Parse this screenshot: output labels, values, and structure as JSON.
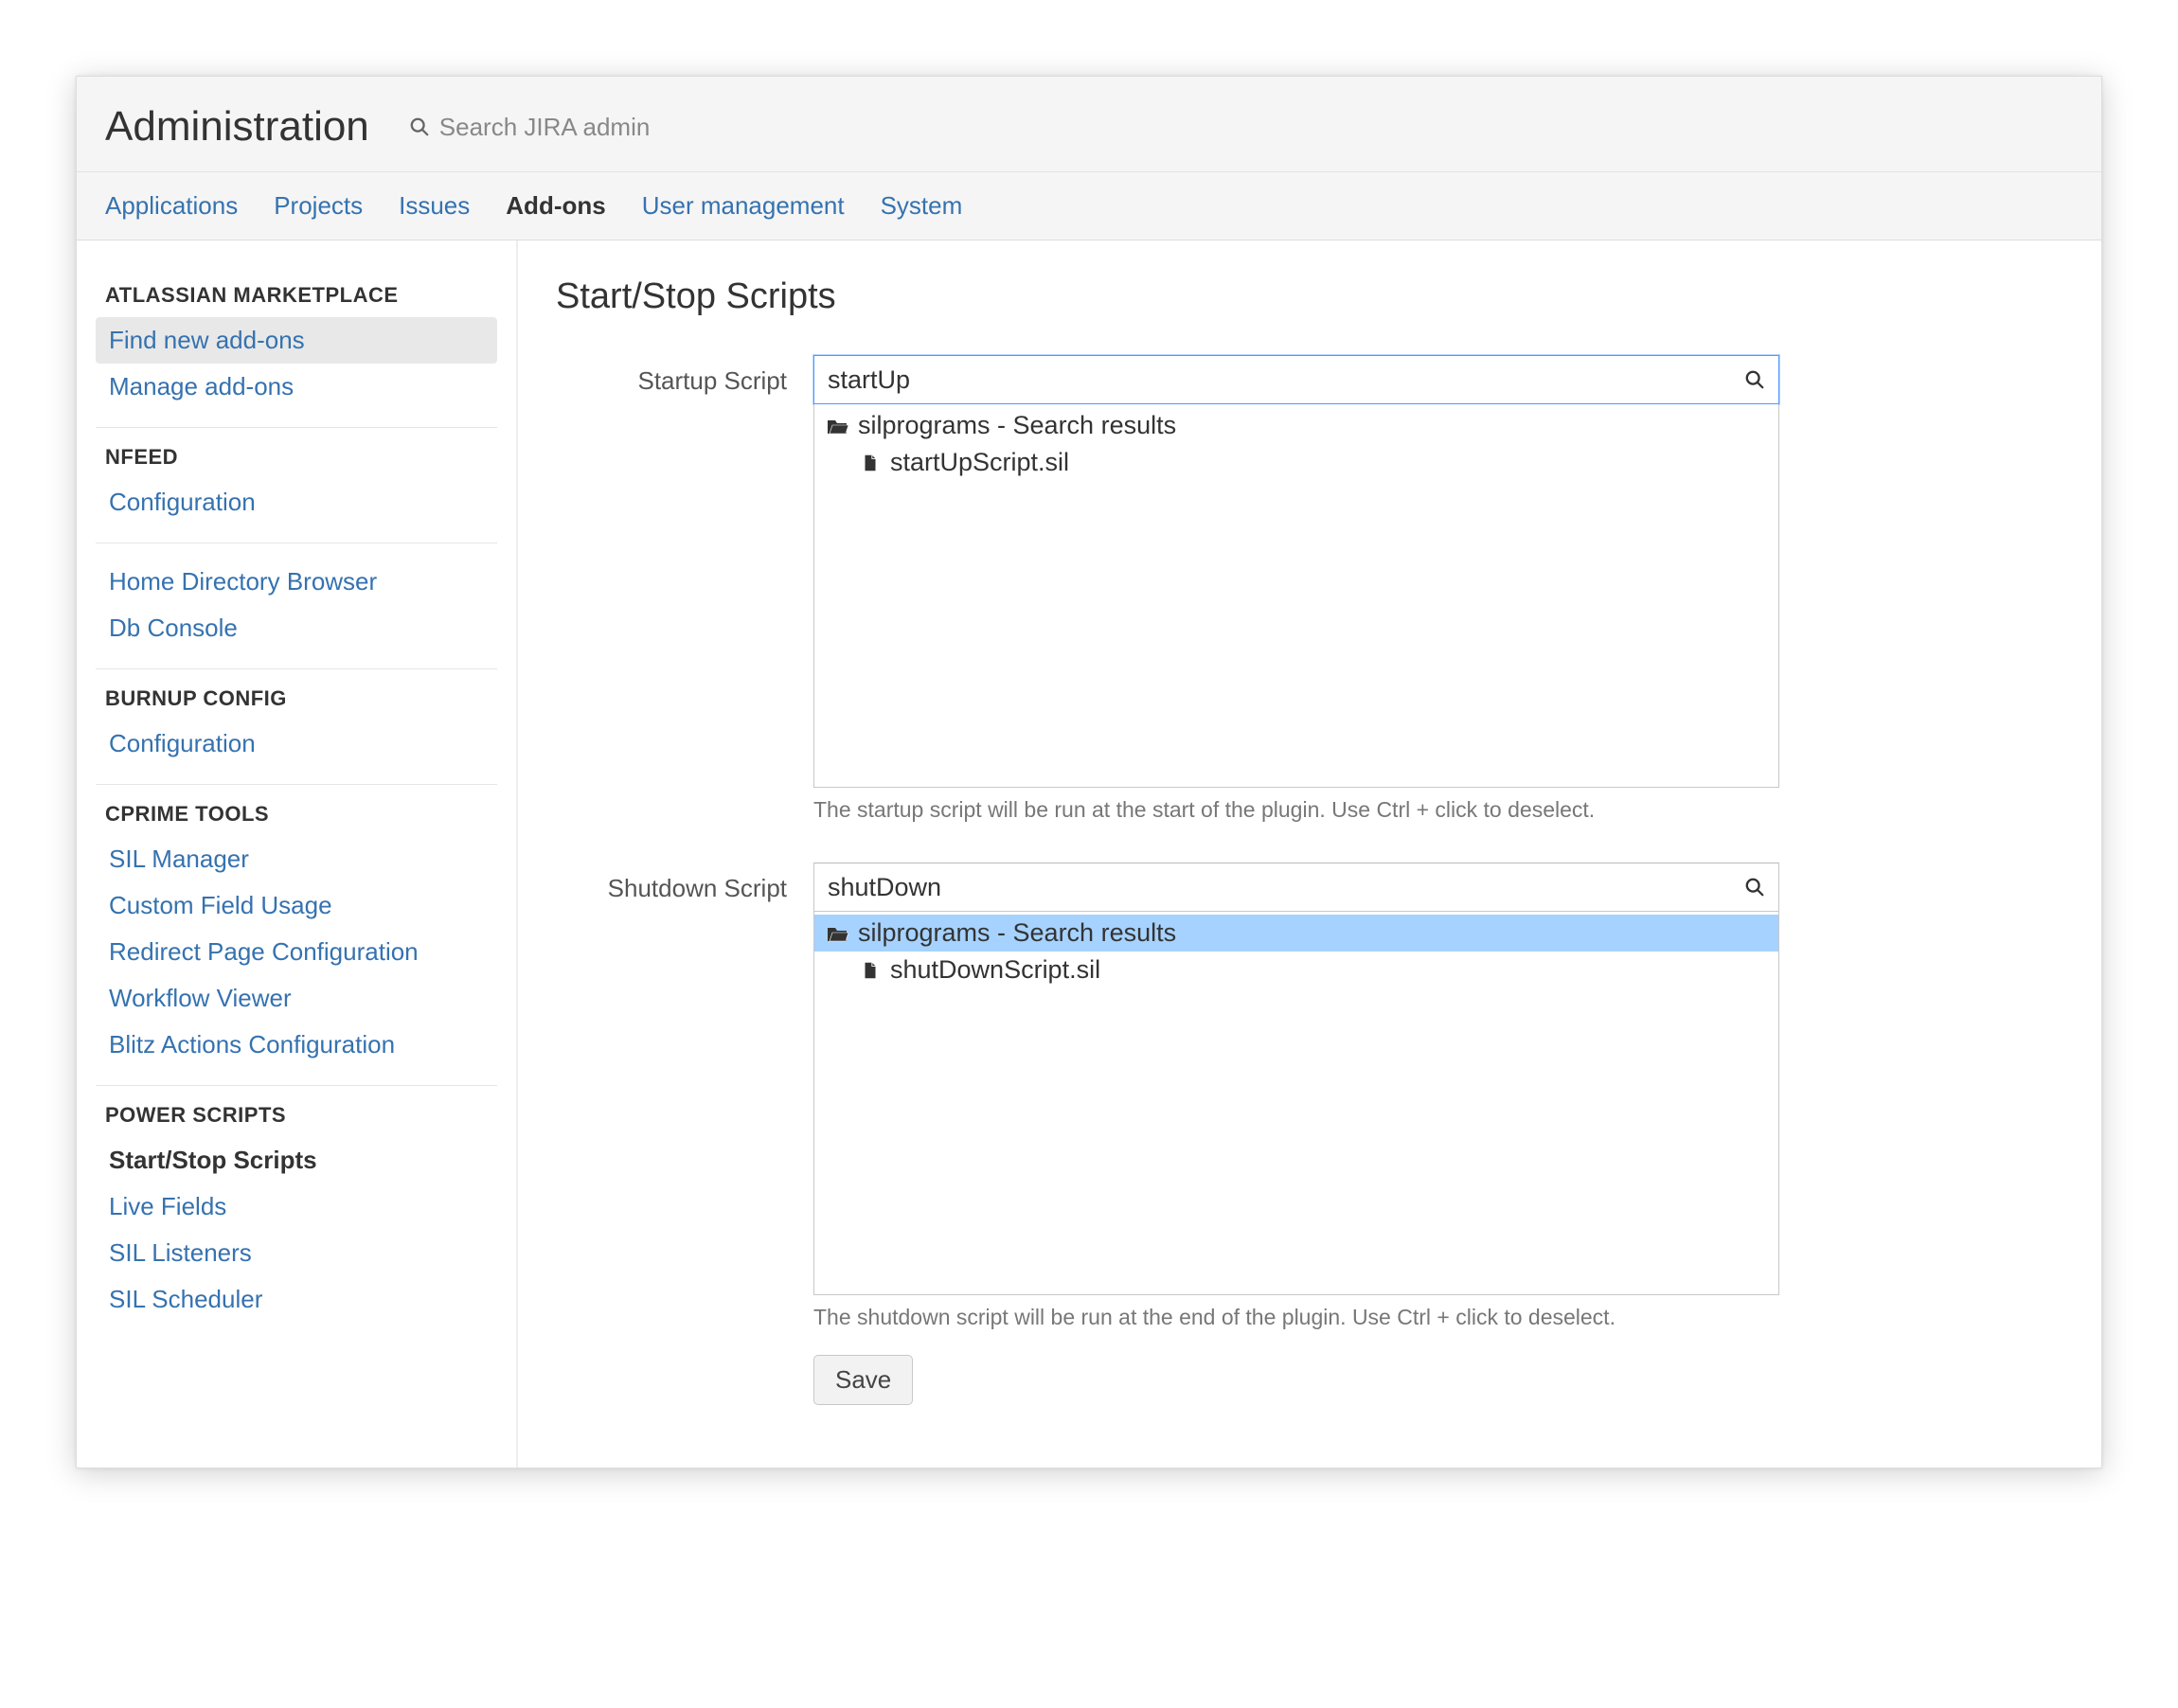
{
  "header": {
    "title": "Administration",
    "search_placeholder": "Search JIRA admin"
  },
  "nav": {
    "items": [
      {
        "label": "Applications",
        "active": false
      },
      {
        "label": "Projects",
        "active": false
      },
      {
        "label": "Issues",
        "active": false
      },
      {
        "label": "Add-ons",
        "active": true
      },
      {
        "label": "User management",
        "active": false
      },
      {
        "label": "System",
        "active": false
      }
    ]
  },
  "sidebar": {
    "sections": [
      {
        "heading": "ATLASSIAN MARKETPLACE",
        "items": [
          {
            "label": "Find new add-ons",
            "state": "selected"
          },
          {
            "label": "Manage add-ons",
            "state": ""
          }
        ]
      },
      {
        "heading": "NFEED",
        "items": [
          {
            "label": "Configuration",
            "state": ""
          }
        ]
      },
      {
        "heading": "",
        "items": [
          {
            "label": "Home Directory Browser",
            "state": ""
          },
          {
            "label": "Db Console",
            "state": ""
          }
        ]
      },
      {
        "heading": "BURNUP CONFIG",
        "items": [
          {
            "label": "Configuration",
            "state": ""
          }
        ]
      },
      {
        "heading": "CPRIME TOOLS",
        "items": [
          {
            "label": "SIL Manager",
            "state": ""
          },
          {
            "label": "Custom Field Usage",
            "state": ""
          },
          {
            "label": "Redirect Page Configuration",
            "state": ""
          },
          {
            "label": "Workflow Viewer",
            "state": ""
          },
          {
            "label": "Blitz Actions Configuration",
            "state": ""
          }
        ]
      },
      {
        "heading": "POWER SCRIPTS",
        "items": [
          {
            "label": "Start/Stop Scripts",
            "state": "active"
          },
          {
            "label": "Live Fields",
            "state": ""
          },
          {
            "label": "SIL Listeners",
            "state": ""
          },
          {
            "label": "SIL Scheduler",
            "state": ""
          }
        ]
      }
    ]
  },
  "main": {
    "title": "Start/Stop Scripts",
    "startup": {
      "label": "Startup Script",
      "value": "startUp",
      "folder_label": "silprograms - Search results",
      "file_label": "startUpScript.sil",
      "help": "The startup script will be run at the start of the plugin. Use Ctrl + click to deselect.",
      "focused": true,
      "folder_selected": false
    },
    "shutdown": {
      "label": "Shutdown Script",
      "value": "shutDown",
      "folder_label": "silprograms - Search results",
      "file_label": "shutDownScript.sil",
      "help": "The shutdown script will be run at the end of the plugin. Use Ctrl + click to deselect.",
      "focused": false,
      "folder_selected": true
    },
    "save_label": "Save"
  }
}
